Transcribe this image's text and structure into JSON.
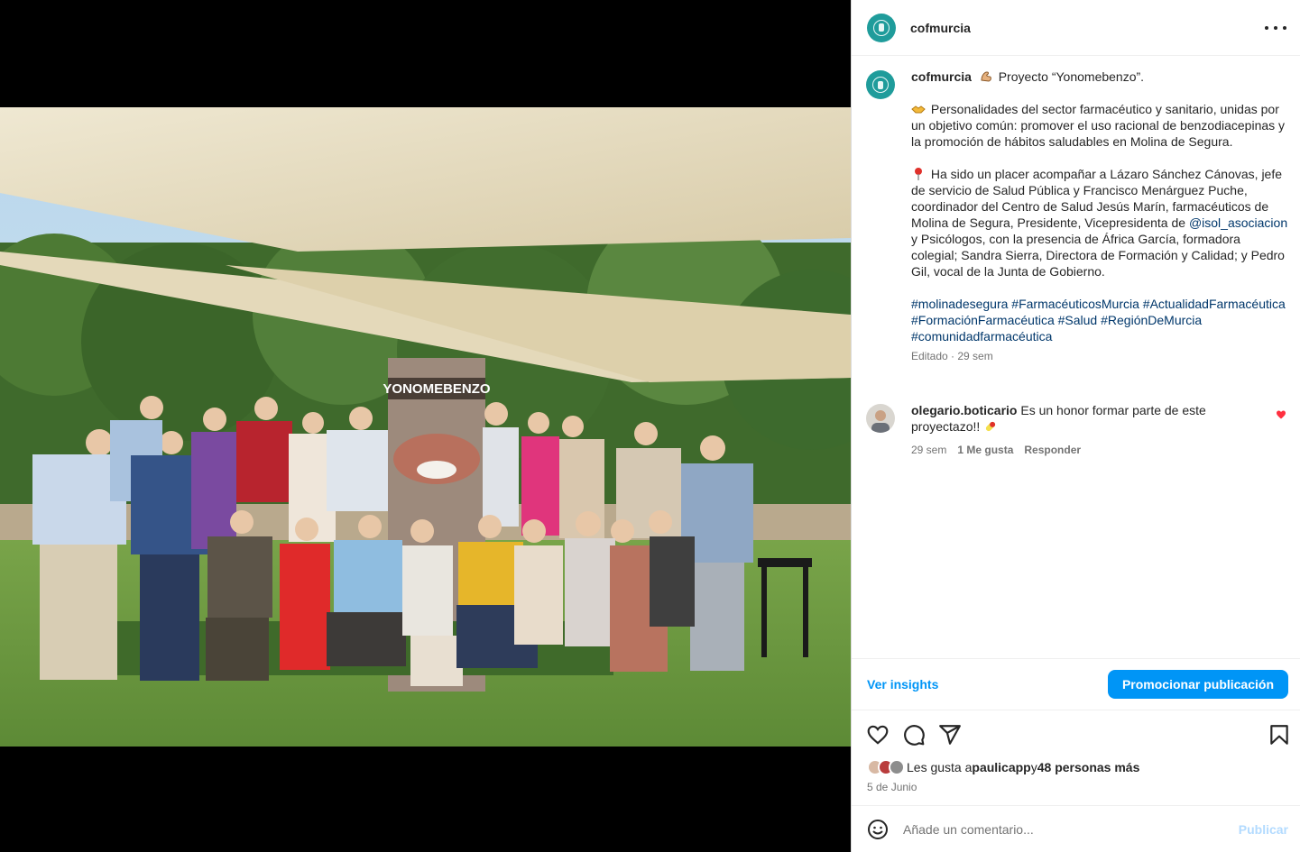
{
  "post": {
    "username": "cofmurcia",
    "photo_banner_text": "YONOMEBENZO",
    "caption": {
      "username": "cofmurcia",
      "line1": " Proyecto “Yonomebenzo”.",
      "para2": " Personalidades del sector farmacéutico y sanitario, unidas por un objetivo común: promover el uso racional de benzodiacepinas y la promoción de hábitos saludables en Molina de Segura.",
      "para3_a": " Ha sido un placer acompañar a Lázaro Sánchez Cánovas, jefe de servicio de Salud Pública y Francisco Menárguez Puche, coordinador del Centro de Salud Jesús Marín, farmacéuticos de Molina de Segura, Presidente, Vicepresidenta de ",
      "mention": "@isol_asociacion",
      "para3_b": " y Psicólogos, con la presencia de África García, formadora colegial; Sandra Sierra, Directora de Formación y Calidad; y Pedro Gil, vocal de la Junta de Gobierno.",
      "hashtags": [
        "#molinadesegura",
        "#FarmacéuticosMurcia",
        "#ActualidadFarmacéutica",
        "#FormaciónFarmacéutica",
        "#Salud",
        "#RegiónDeMurcia",
        "#comunidadfarmacéutica"
      ],
      "meta": "Editado · 29 sem"
    },
    "comment": {
      "username": "olegario.boticario",
      "text": " Es un honor formar parte de este proyectazo!! ",
      "time": "29 sem",
      "likes": "1 Me gusta",
      "reply": "Responder"
    },
    "insights_label": "Ver insights",
    "promote_label": "Promocionar publicación",
    "likes": {
      "prefix": "Les gusta a ",
      "user": "paulicapp",
      "middle": " y ",
      "others": "48 personas más"
    },
    "date": "5 de Junio",
    "comment_placeholder": "Añade un comentario...",
    "publish_label": "Publicar"
  },
  "colors": {
    "accent": "#0095f6",
    "brand_teal": "#1f9c9b",
    "link": "#00376b",
    "like_red": "#ff3040"
  },
  "icons": [
    "more-options-icon",
    "heart-icon",
    "comment-icon",
    "share-icon",
    "bookmark-icon",
    "smiley-icon",
    "flexed-biceps-emoji",
    "handshake-emoji",
    "pushpin-emoji",
    "pill-emoji",
    "small-heart-icon"
  ]
}
